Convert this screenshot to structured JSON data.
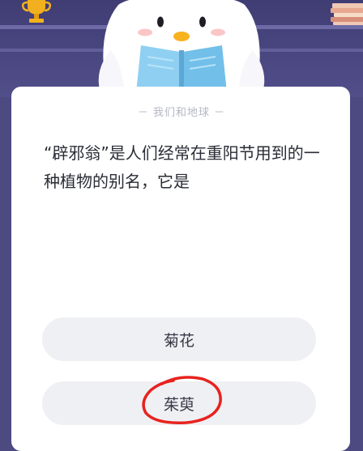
{
  "quiz": {
    "category": "－ 我们和地球 －",
    "question": "“辟邪翁”是人们经常在重阳节用到的一种植物的别名，它是",
    "options": [
      {
        "label": "菊花"
      },
      {
        "label": "茱萸"
      }
    ]
  },
  "colors": {
    "header": "#4d4a82",
    "card": "#ffffff",
    "option_bg": "#eff0f4",
    "annotation": "#e8221e"
  },
  "icons": [
    "trophy-icon",
    "books-icon",
    "mascot-penguin-reading-book",
    "hand-drawn-circle-mark"
  ]
}
